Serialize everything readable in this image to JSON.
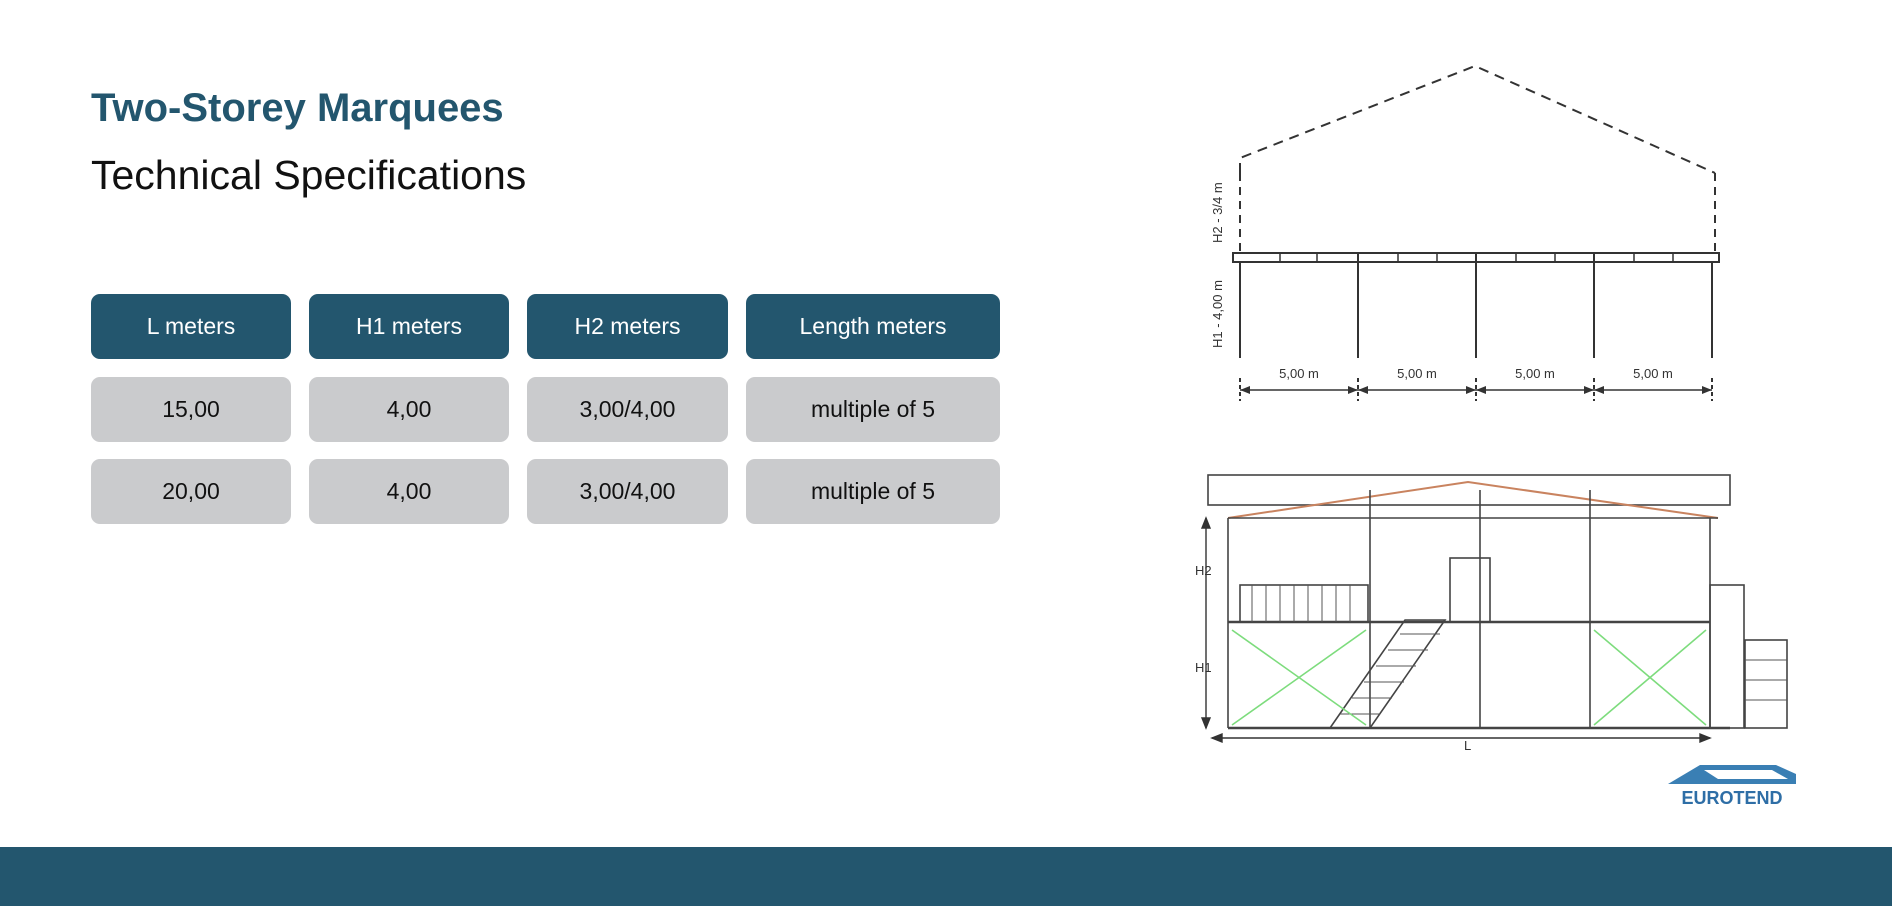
{
  "title": "Two-Storey Marquees",
  "subtitle": "Technical Specifications",
  "table": {
    "headers": [
      "L meters",
      "H1 meters",
      "H2 meters",
      "Length meters"
    ],
    "rows": [
      [
        "15,00",
        "4,00",
        "3,00/4,00",
        "multiple of 5"
      ],
      [
        "20,00",
        "4,00",
        "3,00/4,00",
        "multiple of 5"
      ]
    ]
  },
  "drawing_top": {
    "h2_label": "H2 - 3/4 m",
    "h1_label": "H1 - 4,00 m",
    "bay_labels": [
      "5,00 m",
      "5,00 m",
      "5,00 m",
      "5,00 m"
    ]
  },
  "drawing_bottom": {
    "h2_label": "H2",
    "h1_label": "H1",
    "l_label": "L"
  },
  "logo": {
    "text": "EUROTEND"
  },
  "colors": {
    "accent": "#23566e",
    "cell_bg": "#cacbcd"
  }
}
